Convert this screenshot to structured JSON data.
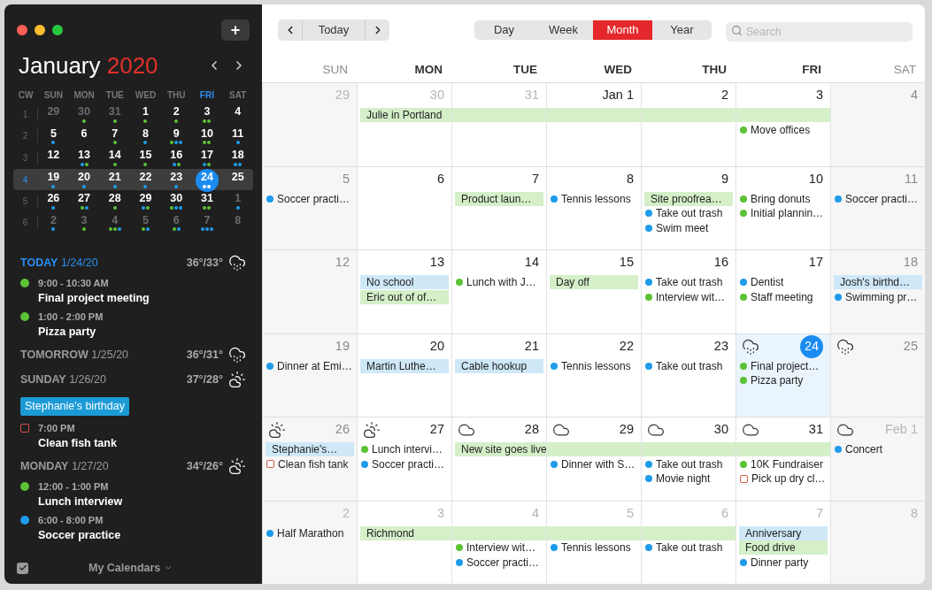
{
  "sidebar": {
    "add_button": "+",
    "month": "January",
    "year": "2020",
    "mini_calendar": {
      "cw_label": "CW",
      "weekdays": [
        {
          "label": "SUN",
          "selected": false
        },
        {
          "label": "MON",
          "selected": false
        },
        {
          "label": "TUE",
          "selected": false
        },
        {
          "label": "WED",
          "selected": false
        },
        {
          "label": "THU",
          "selected": false
        },
        {
          "label": "FRI",
          "selected": true
        },
        {
          "label": "SAT",
          "selected": false
        }
      ],
      "weeks": [
        {
          "cw": "1",
          "selected": false,
          "days": [
            {
              "label": "29",
              "muted": true,
              "selected": false
            },
            {
              "label": "30",
              "muted": true,
              "selected": false,
              "dots": [
                {
                  "color": "#5bc236"
                }
              ]
            },
            {
              "label": "31",
              "muted": true,
              "selected": false,
              "dots": [
                {
                  "color": "#5bc236"
                }
              ]
            },
            {
              "label": "1",
              "muted": false,
              "selected": false,
              "dots": [
                {
                  "color": "#5bc236"
                }
              ]
            },
            {
              "label": "2",
              "muted": false,
              "selected": false,
              "dots": [
                {
                  "color": "#5bc236"
                }
              ]
            },
            {
              "label": "3",
              "muted": false,
              "selected": false,
              "dots": [
                {
                  "color": "#5bc236"
                },
                {
                  "color": "#5bc236"
                }
              ]
            },
            {
              "label": "4",
              "muted": false,
              "selected": false
            }
          ]
        },
        {
          "cw": "2",
          "selected": false,
          "days": [
            {
              "label": "5",
              "muted": false,
              "selected": false,
              "dots": [
                {
                  "color": "#1e9bea"
                }
              ]
            },
            {
              "label": "6",
              "muted": false,
              "selected": false
            },
            {
              "label": "7",
              "muted": false,
              "selected": false,
              "dots": [
                {
                  "color": "#5bc236"
                }
              ]
            },
            {
              "label": "8",
              "muted": false,
              "selected": false,
              "dots": [
                {
                  "color": "#1e9bea"
                }
              ]
            },
            {
              "label": "9",
              "muted": false,
              "selected": false,
              "dots": [
                {
                  "color": "#5bc236"
                },
                {
                  "color": "#1e9bea"
                },
                {
                  "color": "#1e9bea"
                }
              ]
            },
            {
              "label": "10",
              "muted": false,
              "selected": false,
              "dots": [
                {
                  "color": "#5bc236"
                },
                {
                  "color": "#5bc236"
                }
              ]
            },
            {
              "label": "11",
              "muted": false,
              "selected": false,
              "dots": [
                {
                  "color": "#1e9bea"
                }
              ]
            }
          ]
        },
        {
          "cw": "3",
          "selected": false,
          "days": [
            {
              "label": "12",
              "muted": false,
              "selected": false
            },
            {
              "label": "13",
              "muted": false,
              "selected": false,
              "dots": [
                {
                  "color": "#1e9bea"
                },
                {
                  "color": "#5bc236"
                }
              ]
            },
            {
              "label": "14",
              "muted": false,
              "selected": false,
              "dots": [
                {
                  "color": "#5bc236"
                }
              ]
            },
            {
              "label": "15",
              "muted": false,
              "selected": false,
              "dots": [
                {
                  "color": "#5bc236"
                }
              ]
            },
            {
              "label": "16",
              "muted": false,
              "selected": false,
              "dots": [
                {
                  "color": "#1e9bea"
                },
                {
                  "color": "#5bc236"
                }
              ]
            },
            {
              "label": "17",
              "muted": false,
              "selected": false,
              "dots": [
                {
                  "color": "#1e9bea"
                },
                {
                  "color": "#5bc236"
                }
              ]
            },
            {
              "label": "18",
              "muted": false,
              "selected": false,
              "dots": [
                {
                  "color": "#1e9bea"
                },
                {
                  "color": "#1e9bea"
                }
              ]
            }
          ]
        },
        {
          "cw": "4",
          "selected": true,
          "days": [
            {
              "label": "19",
              "muted": false,
              "selected": false,
              "dots": [
                {
                  "color": "#1e9bea"
                }
              ]
            },
            {
              "label": "20",
              "muted": false,
              "selected": false,
              "dots": [
                {
                  "color": "#1e9bea"
                }
              ]
            },
            {
              "label": "21",
              "muted": false,
              "selected": false,
              "dots": [
                {
                  "color": "#1e9bea"
                }
              ]
            },
            {
              "label": "22",
              "muted": false,
              "selected": false,
              "dots": [
                {
                  "color": "#1e9bea"
                }
              ]
            },
            {
              "label": "23",
              "muted": false,
              "selected": false,
              "dots": [
                {
                  "color": "#1e9bea"
                }
              ]
            },
            {
              "label": "24",
              "muted": false,
              "selected": true,
              "dots": [
                {
                  "color": "#ffffff"
                },
                {
                  "color": "#ffffff"
                }
              ]
            },
            {
              "label": "25",
              "muted": false,
              "selected": false
            }
          ]
        },
        {
          "cw": "5",
          "selected": false,
          "days": [
            {
              "label": "26",
              "muted": false,
              "selected": false,
              "dots": [
                {
                  "color": "#1e9bea"
                }
              ]
            },
            {
              "label": "27",
              "muted": false,
              "selected": false,
              "dots": [
                {
                  "color": "#5bc236"
                },
                {
                  "color": "#1e9bea"
                }
              ]
            },
            {
              "label": "28",
              "muted": false,
              "selected": false,
              "dots": [
                {
                  "color": "#5bc236"
                }
              ]
            },
            {
              "label": "29",
              "muted": false,
              "selected": false,
              "dots": [
                {
                  "color": "#1e9bea"
                },
                {
                  "color": "#5bc236"
                }
              ]
            },
            {
              "label": "30",
              "muted": false,
              "selected": false,
              "dots": [
                {
                  "color": "#5bc236"
                },
                {
                  "color": "#1e9bea"
                },
                {
                  "color": "#1e9bea"
                }
              ]
            },
            {
              "label": "31",
              "muted": false,
              "selected": false,
              "dots": [
                {
                  "color": "#5bc236"
                },
                {
                  "color": "#5bc236"
                }
              ]
            },
            {
              "label": "1",
              "muted": true,
              "selected": false,
              "dots": [
                {
                  "color": "#1e9bea"
                }
              ]
            }
          ]
        },
        {
          "cw": "6",
          "selected": false,
          "days": [
            {
              "label": "2",
              "muted": true,
              "selected": false,
              "dots": [
                {
                  "color": "#1e9bea"
                }
              ]
            },
            {
              "label": "3",
              "muted": true,
              "selected": false,
              "dots": [
                {
                  "color": "#5bc236"
                }
              ]
            },
            {
              "label": "4",
              "muted": true,
              "selected": false,
              "dots": [
                {
                  "color": "#5bc236"
                },
                {
                  "color": "#5bc236"
                },
                {
                  "color": "#1e9bea"
                }
              ]
            },
            {
              "label": "5",
              "muted": true,
              "selected": false,
              "dots": [
                {
                  "color": "#5bc236"
                },
                {
                  "color": "#1e9bea"
                }
              ]
            },
            {
              "label": "6",
              "muted": true,
              "selected": false,
              "dots": [
                {
                  "color": "#5bc236"
                },
                {
                  "color": "#1e9bea"
                }
              ]
            },
            {
              "label": "7",
              "muted": true,
              "selected": false,
              "dots": [
                {
                  "color": "#1e9bea"
                },
                {
                  "color": "#1e9bea"
                },
                {
                  "color": "#1e9bea"
                }
              ]
            },
            {
              "label": "8",
              "muted": true,
              "selected": false
            }
          ]
        }
      ]
    },
    "agenda": [
      {
        "title": "TODAY",
        "date": "1/24/20",
        "today": true,
        "temp": "36°/33°",
        "weather": {
          "kind": "rain"
        },
        "items": [
          {
            "kind": "event",
            "color": "#5bc236",
            "time": "9:00 - 10:30 AM",
            "title": "Final project meeting"
          },
          {
            "kind": "event",
            "color": "#5bc236",
            "time": "1:00 - 2:00 PM",
            "title": "Pizza party"
          }
        ]
      },
      {
        "title": "TOMORROW",
        "date": "1/25/20",
        "today": false,
        "temp": "36°/31°",
        "weather": {
          "kind": "rain"
        }
      },
      {
        "title": "SUNDAY",
        "date": "1/26/20",
        "today": false,
        "temp": "37°/28°",
        "weather": {
          "kind": "partly_sunny"
        },
        "items": [
          {
            "kind": "all_day",
            "color": "#1c9ad6",
            "title": "Stephanie's birthday"
          },
          {
            "kind": "task",
            "color": "#d9534f",
            "time": "7:00 PM",
            "title": "Clean fish tank"
          }
        ]
      },
      {
        "title": "MONDAY",
        "date": "1/27/20",
        "today": false,
        "temp": "34°/26°",
        "weather": {
          "kind": "partly_sunny"
        },
        "items": [
          {
            "kind": "event",
            "color": "#5bc236",
            "time": "12:00 - 1:00 PM",
            "title": "Lunch interview"
          },
          {
            "kind": "event",
            "color": "#1e9bea",
            "time": "6:00 - 8:00 PM",
            "title": "Soccer practice"
          }
        ]
      }
    ],
    "footer": {
      "label": "My Calendars",
      "checked": true
    }
  },
  "toolbar": {
    "today": "Today",
    "views": [
      {
        "label": "Day",
        "selected": false
      },
      {
        "label": "Week",
        "selected": false
      },
      {
        "label": "Month",
        "selected": true
      },
      {
        "label": "Year",
        "selected": false
      }
    ],
    "search": {
      "placeholder": "Search"
    }
  },
  "calendar": {
    "weekdays": [
      "SUN",
      "MON",
      "TUE",
      "WED",
      "THU",
      "FRI",
      "SAT"
    ],
    "weeks": [
      {
        "days": [
          {
            "label": "29",
            "muted": true,
            "today": false
          },
          {
            "label": "30",
            "muted": true,
            "today": false,
            "items": [
              {
                "kind": "span_start",
                "color": "#d5efc9",
                "title": "Julie in Portland"
              }
            ]
          },
          {
            "label": "31",
            "muted": true,
            "today": false,
            "items": [
              {
                "kind": "span_continue",
                "color": "#d5efc9"
              }
            ]
          },
          {
            "label": "Jan 1",
            "muted": false,
            "today": false,
            "items": [
              {
                "kind": "span_continue",
                "color": "#d5efc9"
              }
            ]
          },
          {
            "label": "2",
            "muted": false,
            "today": false,
            "items": [
              {
                "kind": "span_continue",
                "color": "#d5efc9"
              }
            ]
          },
          {
            "label": "3",
            "muted": false,
            "today": false,
            "items": [
              {
                "kind": "span_continue",
                "color": "#d5efc9"
              },
              {
                "kind": "dot",
                "color": "#5bc236",
                "title": "Move offices"
              }
            ]
          },
          {
            "label": "4",
            "muted": false,
            "today": false
          }
        ]
      },
      {
        "days": [
          {
            "label": "5",
            "muted": false,
            "today": false,
            "items": [
              {
                "kind": "dot",
                "color": "#1e9bea",
                "title": "Soccer practi…"
              }
            ]
          },
          {
            "label": "6",
            "muted": false,
            "today": false
          },
          {
            "label": "7",
            "muted": false,
            "today": false,
            "items": [
              {
                "kind": "bar",
                "color": "#d5efc9",
                "title": "Product laun…"
              }
            ]
          },
          {
            "label": "8",
            "muted": false,
            "today": false,
            "items": [
              {
                "kind": "dot",
                "color": "#1e9bea",
                "title": "Tennis lessons"
              }
            ]
          },
          {
            "label": "9",
            "muted": false,
            "today": false,
            "items": [
              {
                "kind": "bar",
                "color": "#d5efc9",
                "title": "Site proofrea…"
              },
              {
                "kind": "dot",
                "color": "#1e9bea",
                "title": "Take out trash"
              },
              {
                "kind": "dot",
                "color": "#1e9bea",
                "title": "Swim meet"
              }
            ]
          },
          {
            "label": "10",
            "muted": false,
            "today": false,
            "items": [
              {
                "kind": "dot",
                "color": "#5bc236",
                "title": "Bring donuts"
              },
              {
                "kind": "dot",
                "color": "#5bc236",
                "title": "Initial plannin…"
              }
            ]
          },
          {
            "label": "11",
            "muted": false,
            "today": false,
            "items": [
              {
                "kind": "dot",
                "color": "#1e9bea",
                "title": "Soccer practi…"
              }
            ]
          }
        ]
      },
      {
        "days": [
          {
            "label": "12",
            "muted": false,
            "today": false
          },
          {
            "label": "13",
            "muted": false,
            "today": false,
            "items": [
              {
                "kind": "bar",
                "color": "#cfe8f8",
                "title": "No school"
              },
              {
                "kind": "bar",
                "color": "#d5efc9",
                "title": "Eric out of of…"
              }
            ]
          },
          {
            "label": "14",
            "muted": false,
            "today": false,
            "items": [
              {
                "kind": "dot",
                "color": "#5bc236",
                "title": "Lunch with J…"
              }
            ]
          },
          {
            "label": "15",
            "muted": false,
            "today": false,
            "items": [
              {
                "kind": "bar",
                "color": "#d5efc9",
                "title": "Day off"
              }
            ]
          },
          {
            "label": "16",
            "muted": false,
            "today": false,
            "items": [
              {
                "kind": "dot",
                "color": "#1e9bea",
                "title": "Take out trash"
              },
              {
                "kind": "dot",
                "color": "#5bc236",
                "title": "Interview wit…"
              }
            ]
          },
          {
            "label": "17",
            "muted": false,
            "today": false,
            "items": [
              {
                "kind": "dot",
                "color": "#1e9bea",
                "title": "Dentist"
              },
              {
                "kind": "dot",
                "color": "#5bc236",
                "title": "Staff meeting"
              }
            ]
          },
          {
            "label": "18",
            "muted": false,
            "today": false,
            "items": [
              {
                "kind": "bar",
                "color": "#cfe8f8",
                "title": "Josh's birthd…"
              },
              {
                "kind": "dot",
                "color": "#1e9bea",
                "title": "Swimming pr…"
              }
            ]
          }
        ]
      },
      {
        "days": [
          {
            "label": "19",
            "muted": false,
            "today": false,
            "items": [
              {
                "kind": "dot",
                "color": "#1e9bea",
                "title": "Dinner at Emi…"
              }
            ]
          },
          {
            "label": "20",
            "muted": false,
            "today": false,
            "items": [
              {
                "kind": "bar",
                "color": "#cfe8f8",
                "title": "Martin Luthe…"
              }
            ]
          },
          {
            "label": "21",
            "muted": false,
            "today": false,
            "items": [
              {
                "kind": "bar",
                "color": "#cfe8f8",
                "title": "Cable hookup"
              }
            ]
          },
          {
            "label": "22",
            "muted": false,
            "today": false,
            "items": [
              {
                "kind": "dot",
                "color": "#1e9bea",
                "title": "Tennis lessons"
              }
            ]
          },
          {
            "label": "23",
            "muted": false,
            "today": false,
            "items": [
              {
                "kind": "dot",
                "color": "#1e9bea",
                "title": "Take out trash"
              }
            ]
          },
          {
            "label": "24",
            "muted": false,
            "today": true,
            "weather": {
              "kind": "rain"
            },
            "items": [
              {
                "kind": "dot",
                "color": "#5bc236",
                "title": "Final project…"
              },
              {
                "kind": "dot",
                "color": "#5bc236",
                "title": "Pizza party"
              }
            ]
          },
          {
            "label": "25",
            "muted": false,
            "today": false,
            "weather": {
              "kind": "rain"
            }
          }
        ]
      },
      {
        "days": [
          {
            "label": "26",
            "muted": false,
            "today": false,
            "weather": {
              "kind": "partly_sunny"
            },
            "items": [
              {
                "kind": "bar",
                "color": "#cfe8f8",
                "title": "Stephanie's…"
              },
              {
                "kind": "task",
                "color": "#e05a4a",
                "title": "Clean fish tank"
              }
            ]
          },
          {
            "label": "27",
            "muted": false,
            "today": false,
            "weather": {
              "kind": "partly_sunny"
            },
            "items": [
              {
                "kind": "dot",
                "color": "#5bc236",
                "title": "Lunch intervi…"
              },
              {
                "kind": "dot",
                "color": "#1e9bea",
                "title": "Soccer practi…"
              }
            ]
          },
          {
            "label": "28",
            "muted": false,
            "today": false,
            "weather": {
              "kind": "cloudy"
            },
            "items": [
              {
                "kind": "span_start",
                "color": "#d5efc9",
                "title": "New site goes live"
              }
            ]
          },
          {
            "label": "29",
            "muted": false,
            "today": false,
            "weather": {
              "kind": "cloudy"
            },
            "items": [
              {
                "kind": "span_continue",
                "color": "#d5efc9"
              },
              {
                "kind": "dot",
                "color": "#1e9bea",
                "title": "Dinner with S…"
              }
            ]
          },
          {
            "label": "30",
            "muted": false,
            "today": false,
            "weather": {
              "kind": "cloudy"
            },
            "items": [
              {
                "kind": "span_continue",
                "color": "#d5efc9"
              },
              {
                "kind": "dot",
                "color": "#1e9bea",
                "title": "Take out trash"
              },
              {
                "kind": "dot",
                "color": "#1e9bea",
                "title": "Movie night"
              }
            ]
          },
          {
            "label": "31",
            "muted": false,
            "today": false,
            "weather": {
              "kind": "cloudy"
            },
            "items": [
              {
                "kind": "span_continue",
                "color": "#d5efc9"
              },
              {
                "kind": "dot",
                "color": "#5bc236",
                "title": "10K Fundraiser"
              },
              {
                "kind": "task",
                "color": "#e05a4a",
                "title": "Pick up dry cl…"
              }
            ]
          },
          {
            "label": "Feb 1",
            "muted": true,
            "today": false,
            "weather": {
              "kind": "cloudy"
            },
            "items": [
              {
                "kind": "dot",
                "color": "#1e9bea",
                "title": "Concert"
              }
            ]
          }
        ]
      },
      {
        "days": [
          {
            "label": "2",
            "muted": true,
            "today": false,
            "items": [
              {
                "kind": "dot",
                "color": "#1e9bea",
                "title": "Half Marathon"
              }
            ]
          },
          {
            "label": "3",
            "muted": true,
            "today": false,
            "items": [
              {
                "kind": "span_start",
                "color": "#d5efc9",
                "title": "Richmond"
              }
            ]
          },
          {
            "label": "4",
            "muted": true,
            "today": false,
            "items": [
              {
                "kind": "span_continue",
                "color": "#d5efc9"
              },
              {
                "kind": "dot",
                "color": "#5bc236",
                "title": "Interview wit…"
              },
              {
                "kind": "dot",
                "color": "#1e9bea",
                "title": "Soccer practi…"
              }
            ]
          },
          {
            "label": "5",
            "muted": true,
            "today": false,
            "items": [
              {
                "kind": "span_continue",
                "color": "#d5efc9"
              },
              {
                "kind": "dot",
                "color": "#1e9bea",
                "title": "Tennis lessons"
              }
            ]
          },
          {
            "label": "6",
            "muted": true,
            "today": false,
            "items": [
              {
                "kind": "span_continue",
                "color": "#d5efc9"
              },
              {
                "kind": "dot",
                "color": "#1e9bea",
                "title": "Take out trash"
              }
            ]
          },
          {
            "label": "7",
            "muted": true,
            "today": false,
            "items": [
              {
                "kind": "bar",
                "color": "#cfe8f8",
                "title": "Anniversary"
              },
              {
                "kind": "bar",
                "color": "#d5efc9",
                "title": "Food drive"
              },
              {
                "kind": "dot",
                "color": "#1e9bea",
                "title": "Dinner party"
              }
            ]
          },
          {
            "label": "8",
            "muted": true,
            "today": false
          }
        ]
      }
    ]
  }
}
